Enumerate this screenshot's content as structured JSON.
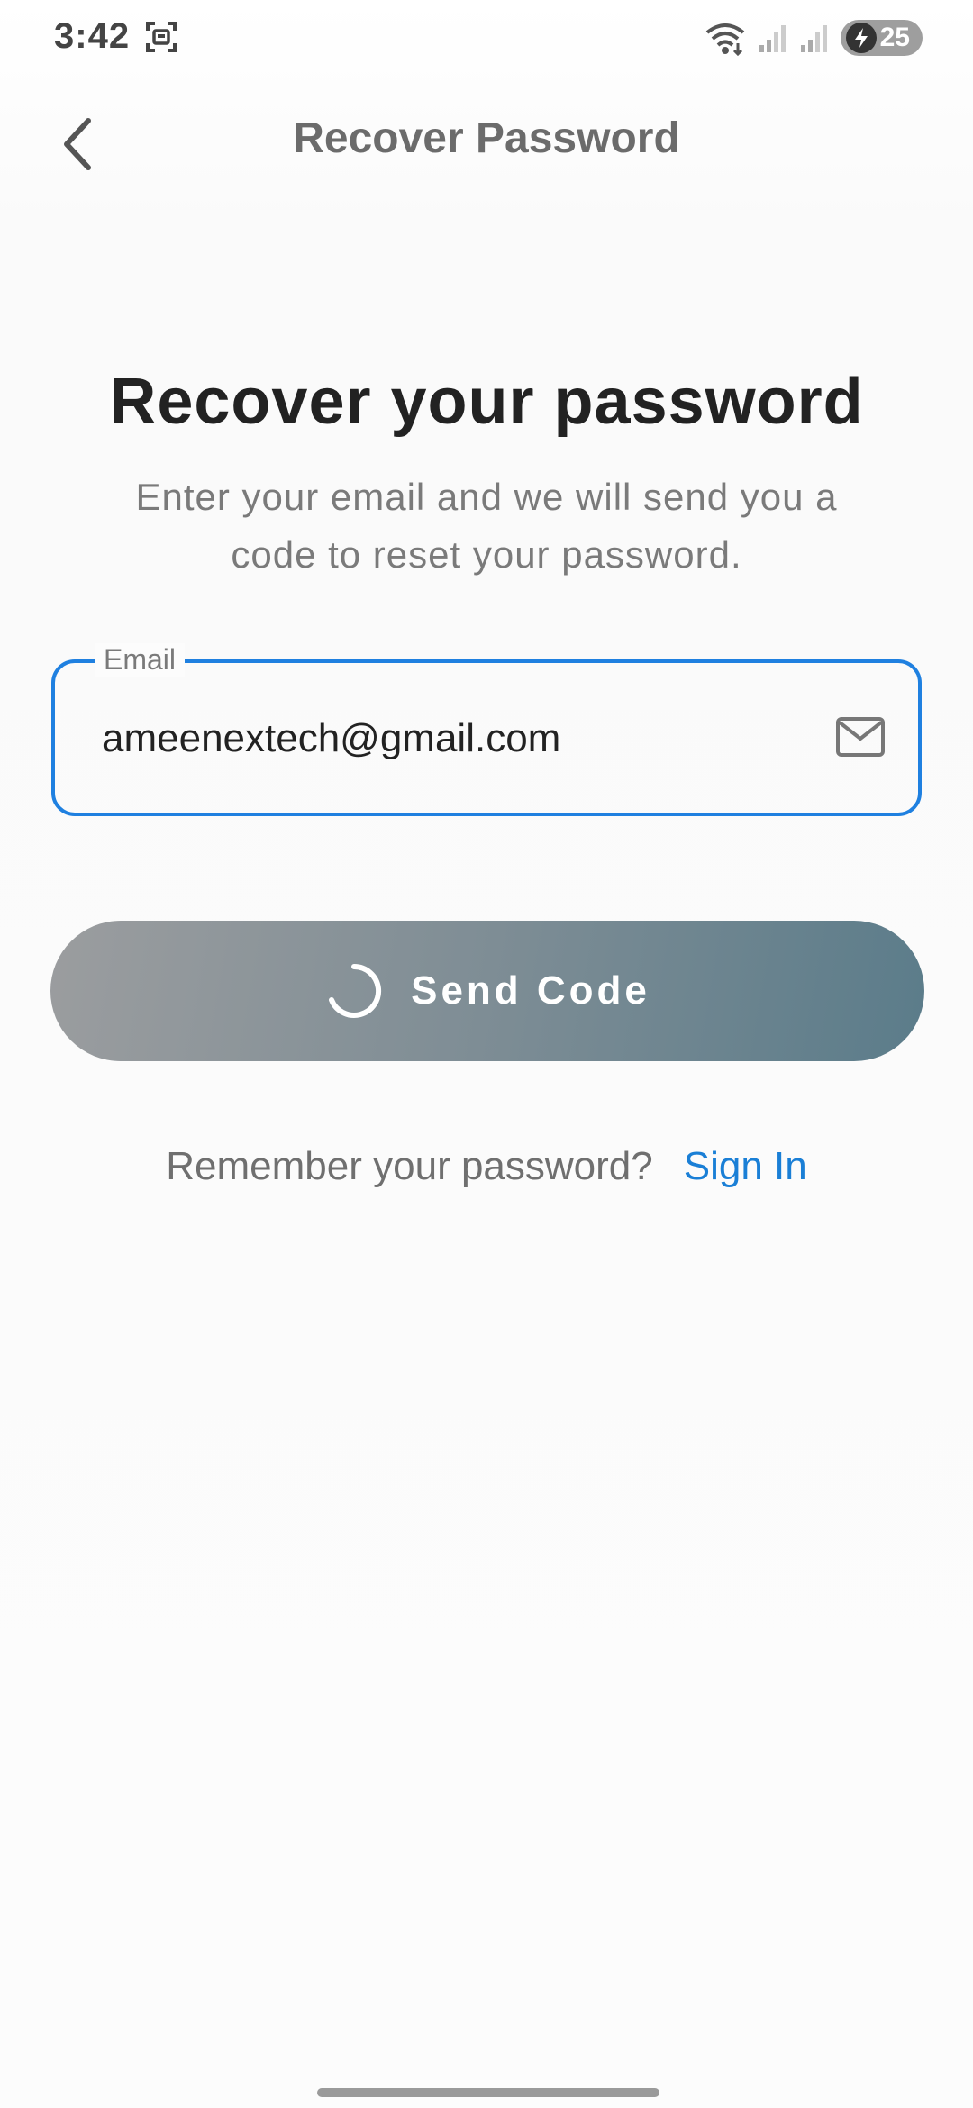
{
  "status_bar": {
    "time": "3:42",
    "battery_level": "25"
  },
  "app_bar": {
    "title": "Recover Password"
  },
  "content": {
    "headline": "Recover your password",
    "subtitle": "Enter your email and we will send you a code to reset your password.",
    "email_label": "Email",
    "email_value": "ameenextech@gmail.com",
    "send_button_label": "Send Code",
    "signin_prompt": "Remember your password?",
    "signin_link": "Sign In"
  },
  "colors": {
    "accent_blue": "#1f80e0",
    "link_blue": "#1a7fd6",
    "button_gradient_start": "#9b9d9f",
    "button_gradient_end": "#5b7c8a"
  },
  "icons": {
    "back": "chevron-left-icon",
    "mail": "mail-icon",
    "loading": "spinner-icon",
    "wifi": "wifi-icon",
    "signal": "signal-icon",
    "screenshot": "screenshot-icon",
    "battery_charging": "bolt-icon"
  }
}
